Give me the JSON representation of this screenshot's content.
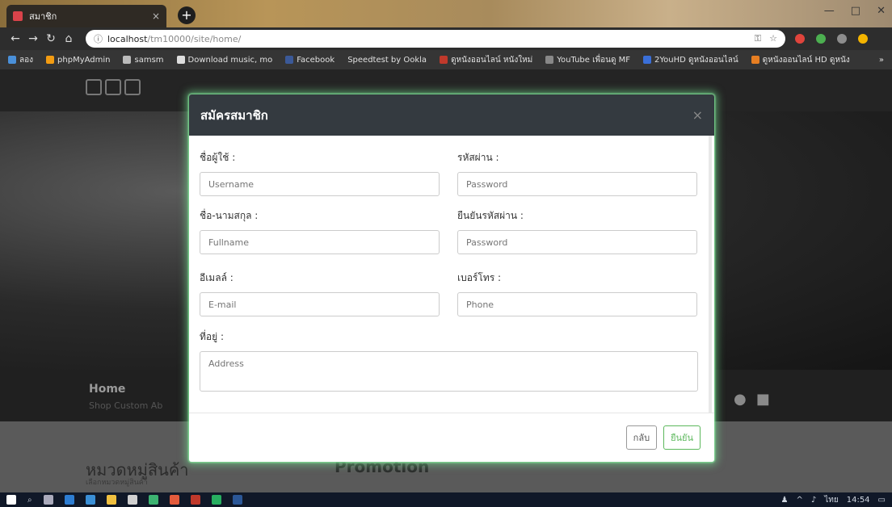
{
  "browser": {
    "tab_title": "สมาชิก",
    "tab_close": "×",
    "new_tab": "+",
    "url_host": "localhost",
    "url_path": "/tm10000/site/home/",
    "window_controls": [
      "—",
      "□",
      "✕"
    ],
    "bookmarks": [
      "ลอง",
      "phpMyAdmin",
      "samsm",
      "Download music, mo",
      "Facebook",
      "Speedtest by Ookla",
      "ดูหนังออนไลน์ หนังใหม่",
      "YouTube เพื่อนดู MF",
      "2YouHD ดูหนังออนไลน์",
      "ดูหนังออนไลน์ HD ดูหนัง"
    ],
    "bookmarks_more": "»"
  },
  "page": {
    "nav_home": "Home",
    "nav_links": "Shop   Custom   Ab",
    "category_title": "หมวดหมู่สินค้า",
    "category_sub": "เลือกหมวดหมู่สินค้า",
    "promotion": "Promotion"
  },
  "modal": {
    "title": "สมัครสมาชิก",
    "close": "×",
    "fields": {
      "username": {
        "label": "ชื่อผู้ใช้ :",
        "placeholder": "Username"
      },
      "password": {
        "label": "รหัสผ่าน :",
        "placeholder": "Password"
      },
      "fullname": {
        "label": "ชื่อ-นามสกุล :",
        "placeholder": "Fullname"
      },
      "confirm_password": {
        "label": "ยืนยันรหัสผ่าน :",
        "placeholder": "Password"
      },
      "email": {
        "label": "อีเมลล์ :",
        "placeholder": "E-mail"
      },
      "phone": {
        "label": "เบอร์โทร :",
        "placeholder": "Phone"
      },
      "address": {
        "label": "ที่อยู่ :",
        "placeholder": "Address"
      }
    },
    "buttons": {
      "back": "กลับ",
      "confirm": "ยืนยัน"
    }
  },
  "taskbar": {
    "tray_text": "ไทย",
    "time": "14:54"
  }
}
